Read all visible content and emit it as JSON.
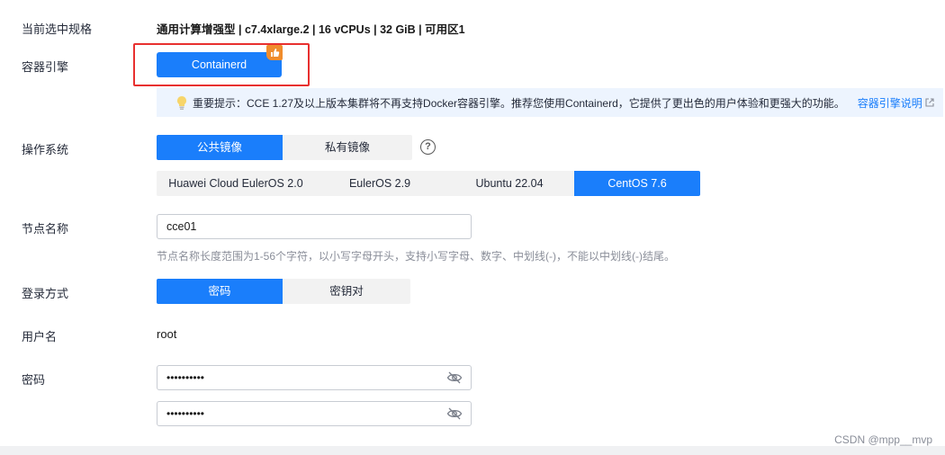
{
  "spec": {
    "label": "当前选中规格",
    "value": "通用计算增强型 | c7.4xlarge.2 | 16 vCPUs | 32 GiB | 可用区1"
  },
  "engine": {
    "label": "容器引擎",
    "button": "Containerd",
    "badge_icon": "thumbs-up-icon",
    "highlight_color": "#e8302f"
  },
  "tip": {
    "icon": "lightbulb-icon",
    "text": "重要提示：CCE 1.27及以上版本集群将不再支持Docker容器引擎。推荐您使用Containerd，它提供了更出色的用户体验和更强大的功能。",
    "link": "容器引擎说明",
    "link_icon": "external-link-icon"
  },
  "os": {
    "label": "操作系统",
    "tabs": [
      "公共镜像",
      "私有镜像"
    ],
    "selected_tab": "公共镜像",
    "images": [
      "Huawei Cloud EulerOS 2.0",
      "EulerOS 2.9",
      "Ubuntu 22.04",
      "CentOS 7.6"
    ],
    "selected_image": "CentOS 7.6",
    "help_icon": "?"
  },
  "node_name": {
    "label": "节点名称",
    "value": "cce01",
    "hint": "节点名称长度范围为1-56个字符，以小写字母开头，支持小写字母、数字、中划线(-)，不能以中划线(-)结尾。"
  },
  "login": {
    "label": "登录方式",
    "options": [
      "密码",
      "密钥对"
    ],
    "selected": "密码"
  },
  "username": {
    "label": "用户名",
    "value": "root"
  },
  "password": {
    "label": "密码",
    "value": "••••••••••",
    "confirm_value": "••••••••••",
    "toggle_icon": "eye-off-icon"
  },
  "watermark": "CSDN @mpp__mvp",
  "colors": {
    "primary": "#1a7efb",
    "tip_bg": "#edf4fe",
    "badge": "#f08c2c"
  }
}
